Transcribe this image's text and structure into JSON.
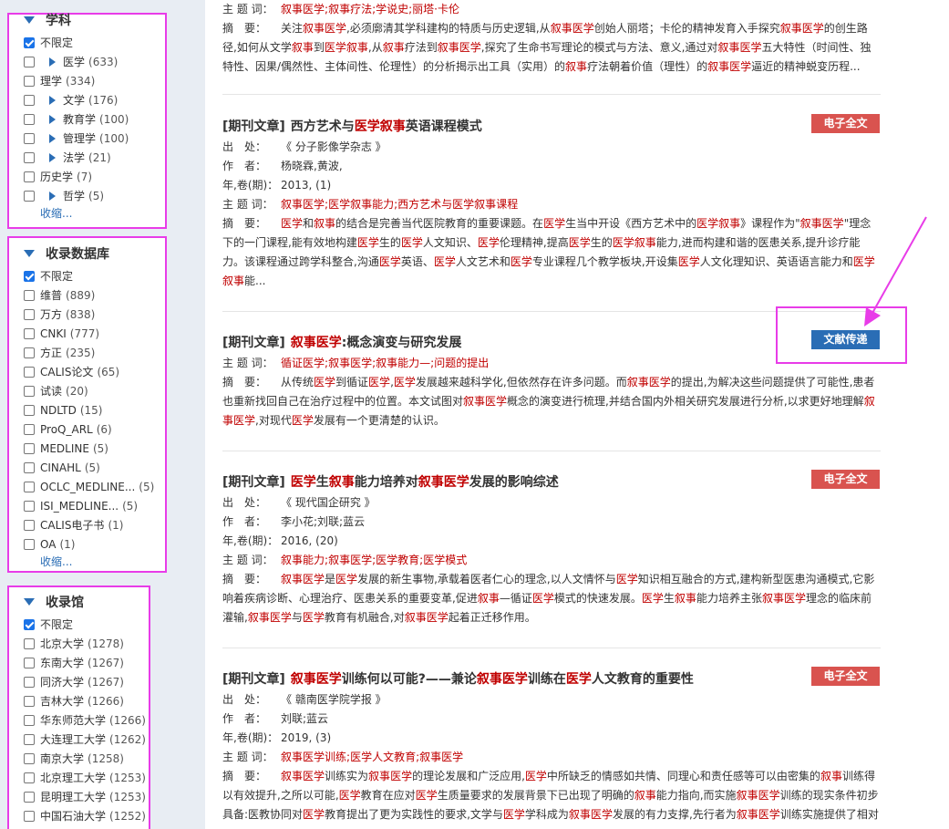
{
  "sidebar": {
    "subject": {
      "title": "学科",
      "items": [
        {
          "label": "不限定",
          "count": "",
          "checked": true,
          "expand": false
        },
        {
          "label": "医学",
          "count": "(633)",
          "checked": false,
          "expand": true
        },
        {
          "label": "理学",
          "count": "(334)",
          "checked": false,
          "expand": false
        },
        {
          "label": "文学",
          "count": "(176)",
          "checked": false,
          "expand": true
        },
        {
          "label": "教育学",
          "count": "(100)",
          "checked": false,
          "expand": true
        },
        {
          "label": "管理学",
          "count": "(100)",
          "checked": false,
          "expand": true
        },
        {
          "label": "法学",
          "count": "(21)",
          "checked": false,
          "expand": true
        },
        {
          "label": "历史学",
          "count": "(7)",
          "checked": false,
          "expand": false
        },
        {
          "label": "哲学",
          "count": "(5)",
          "checked": false,
          "expand": true
        }
      ],
      "collapse": "收缩..."
    },
    "database": {
      "title": "收录数据库",
      "items": [
        {
          "label": "不限定",
          "count": "",
          "checked": true
        },
        {
          "label": "维普",
          "count": "(889)",
          "checked": false
        },
        {
          "label": "万方",
          "count": "(838)",
          "checked": false
        },
        {
          "label": "CNKI",
          "count": "(777)",
          "checked": false
        },
        {
          "label": "方正",
          "count": "(235)",
          "checked": false
        },
        {
          "label": "CALIS论文",
          "count": "(65)",
          "checked": false
        },
        {
          "label": "试读",
          "count": "(20)",
          "checked": false
        },
        {
          "label": "NDLTD",
          "count": "(15)",
          "checked": false
        },
        {
          "label": "ProQ_ARL",
          "count": "(6)",
          "checked": false
        },
        {
          "label": "MEDLINE",
          "count": "(5)",
          "checked": false
        },
        {
          "label": "CINAHL",
          "count": "(5)",
          "checked": false
        },
        {
          "label": "OCLC_MEDLINE...",
          "count": "(5)",
          "checked": false
        },
        {
          "label": "ISI_MEDLINE...",
          "count": "(5)",
          "checked": false
        },
        {
          "label": "CALIS电子书",
          "count": "(1)",
          "checked": false
        },
        {
          "label": "OA",
          "count": "(1)",
          "checked": false
        }
      ],
      "collapse": "收缩..."
    },
    "library": {
      "title": "收录馆",
      "items": [
        {
          "label": "不限定",
          "count": "",
          "checked": true
        },
        {
          "label": "北京大学",
          "count": "(1278)",
          "checked": false
        },
        {
          "label": "东南大学",
          "count": "(1267)",
          "checked": false
        },
        {
          "label": "同济大学",
          "count": "(1267)",
          "checked": false
        },
        {
          "label": "吉林大学",
          "count": "(1266)",
          "checked": false
        },
        {
          "label": "华东师范大学",
          "count": "(1266)",
          "checked": false
        },
        {
          "label": "大连理工大学",
          "count": "(1262)",
          "checked": false
        },
        {
          "label": "南京大学",
          "count": "(1258)",
          "checked": false
        },
        {
          "label": "北京理工大学",
          "count": "(1253)",
          "checked": false
        },
        {
          "label": "昆明理工大学",
          "count": "(1253)",
          "checked": false
        },
        {
          "label": "中国石油大学",
          "count": "(1252)",
          "checked": false
        }
      ]
    }
  },
  "labels": {
    "source": "出　处：",
    "author": "作　者：",
    "year": "年,卷(期)：",
    "keywords": "主 题 词：",
    "abstract": "摘　要：",
    "type": "[期刊文章]"
  },
  "records": [
    {
      "keywords": "叙事医学;叙事疗法;学说史;丽塔·卡伦",
      "abstract": "关注叙事医学,必须廓清其学科建构的特质与历史逻辑,从叙事医学创始人丽塔；卡伦的精神发育入手探究叙事医学的创生路径,如何从文学叙事到医学叙事,从叙事疗法到叙事医学,探究了生命书写理论的模式与方法、意义,通过对叙事医学五大特性（时间性、独特性、因果/偶然性、主体间性、伦理性）的分析揭示出工具（实用）的叙事疗法朝着价值（理性）的叙事医学逼近的精神蜕变历程..."
    },
    {
      "title": "西方艺术与医学叙事英语课程模式",
      "source": "《 分子影像学杂志 》",
      "author": "杨晓霖,黄波,",
      "year": "2013, (1)",
      "keywords": "叙事医学;医学叙事能力;西方艺术与医学叙事课程",
      "abstract": "医学和叙事的结合是完善当代医院教育的重要课题。在医学生当中开设《西方艺术中的医学叙事》课程作为\"叙事医学\"理念下的一门课程,能有效地构建医学生的医学人文知识、医学伦理精神,提高医学生的医学叙事能力,进而构建和谐的医患关系,提升诊疗能力。该课程通过跨学科整合,沟通医学英语、医学人文艺术和医学专业课程几个教学板块,开设集医学人文化理知识、英语语言能力和医学叙事能...",
      "button": "电子全文"
    },
    {
      "title": "叙事医学:概念演变与研究发展",
      "keywords": "循证医学;叙事医学;叙事能力—;问题的提出",
      "abstract": "从传统医学到循证医学,医学发展越来越科学化,但依然存在许多问题。而叙事医学的提出,为解决这些问题提供了可能性,患者也重新找回自己在治疗过程中的位置。本文试图对叙事医学概念的演变进行梳理,并结合国内外相关研究发展进行分析,以求更好地理解叙事医学,对现代医学发展有一个更清楚的认识。",
      "button": "文献传递"
    },
    {
      "title": "医学生叙事能力培养对叙事医学发展的影响综述",
      "source": "《 现代国企研究 》",
      "author": "李小花;刘联;蓝云",
      "year": "2016, (20)",
      "keywords": "叙事能力;叙事医学;医学教育;医学模式",
      "abstract": "叙事医学是医学发展的新生事物,承载着医者仁心的理念,以人文情怀与医学知识相互融合的方式,建构新型医患沟通模式,它影响着疾病诊断、心理治疗、医患关系的重要变革,促进叙事—循证医学模式的快速发展。医学生叙事能力培养主张叙事医学理念的临床前灌输,叙事医学与医学教育有机融合,对叙事医学起着正迁移作用。",
      "button": "电子全文"
    },
    {
      "title": "叙事医学训练何以可能?——兼论叙事医学训练在医学人文教育的重要性",
      "source": "《 赣南医学院学报 》",
      "author": "刘联;蓝云",
      "year": "2019, (3)",
      "keywords": "叙事医学训练;医学人文教育;叙事医学",
      "abstract": "叙事医学训练实为叙事医学的理论发展和广泛应用,医学中所缺乏的情感如共情、同理心和责任感等可以由密集的叙事训练得以有效提升,之所以可能,医学教育在应对医学生质量要求的发展背景下已出现了明确的叙事能力指向,而实施叙事医学训练的现实条件初步具备:医教协同对医学教育提出了更为实践性的要求,文学与医学学科成为叙事医学发展的有力支撑,先行者为叙事医学训练实施提供了相对",
      "button": "电子全文"
    }
  ],
  "colors": {
    "highlight": "#c00000",
    "fulltext_button": "#d9534f",
    "delivery_button": "#2a6db5",
    "annotation": "#e83ce8"
  }
}
